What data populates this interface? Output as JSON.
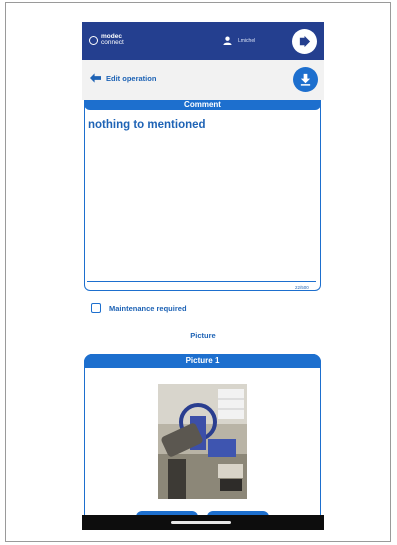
{
  "app": {
    "logo_line1": "modec",
    "logo_line2": "connect",
    "user_name": "Lmichel"
  },
  "header": {
    "back_label": "Edit operation"
  },
  "comment": {
    "title": "Comment",
    "text": "nothing to mentioned",
    "counter": "22/500"
  },
  "maintenance": {
    "label": "Maintenance required",
    "checked": false
  },
  "pictures": {
    "section_label": "Picture",
    "items": [
      {
        "title": "Picture 1"
      }
    ]
  },
  "colors": {
    "topbar": "#243f8f",
    "accent": "#1d6fce",
    "text_blue": "#1e63b5",
    "subbar_bg": "#f2f2f2"
  },
  "icons": [
    "logo-icon",
    "user-icon",
    "logout-icon",
    "back-arrow-icon",
    "download-icon"
  ]
}
